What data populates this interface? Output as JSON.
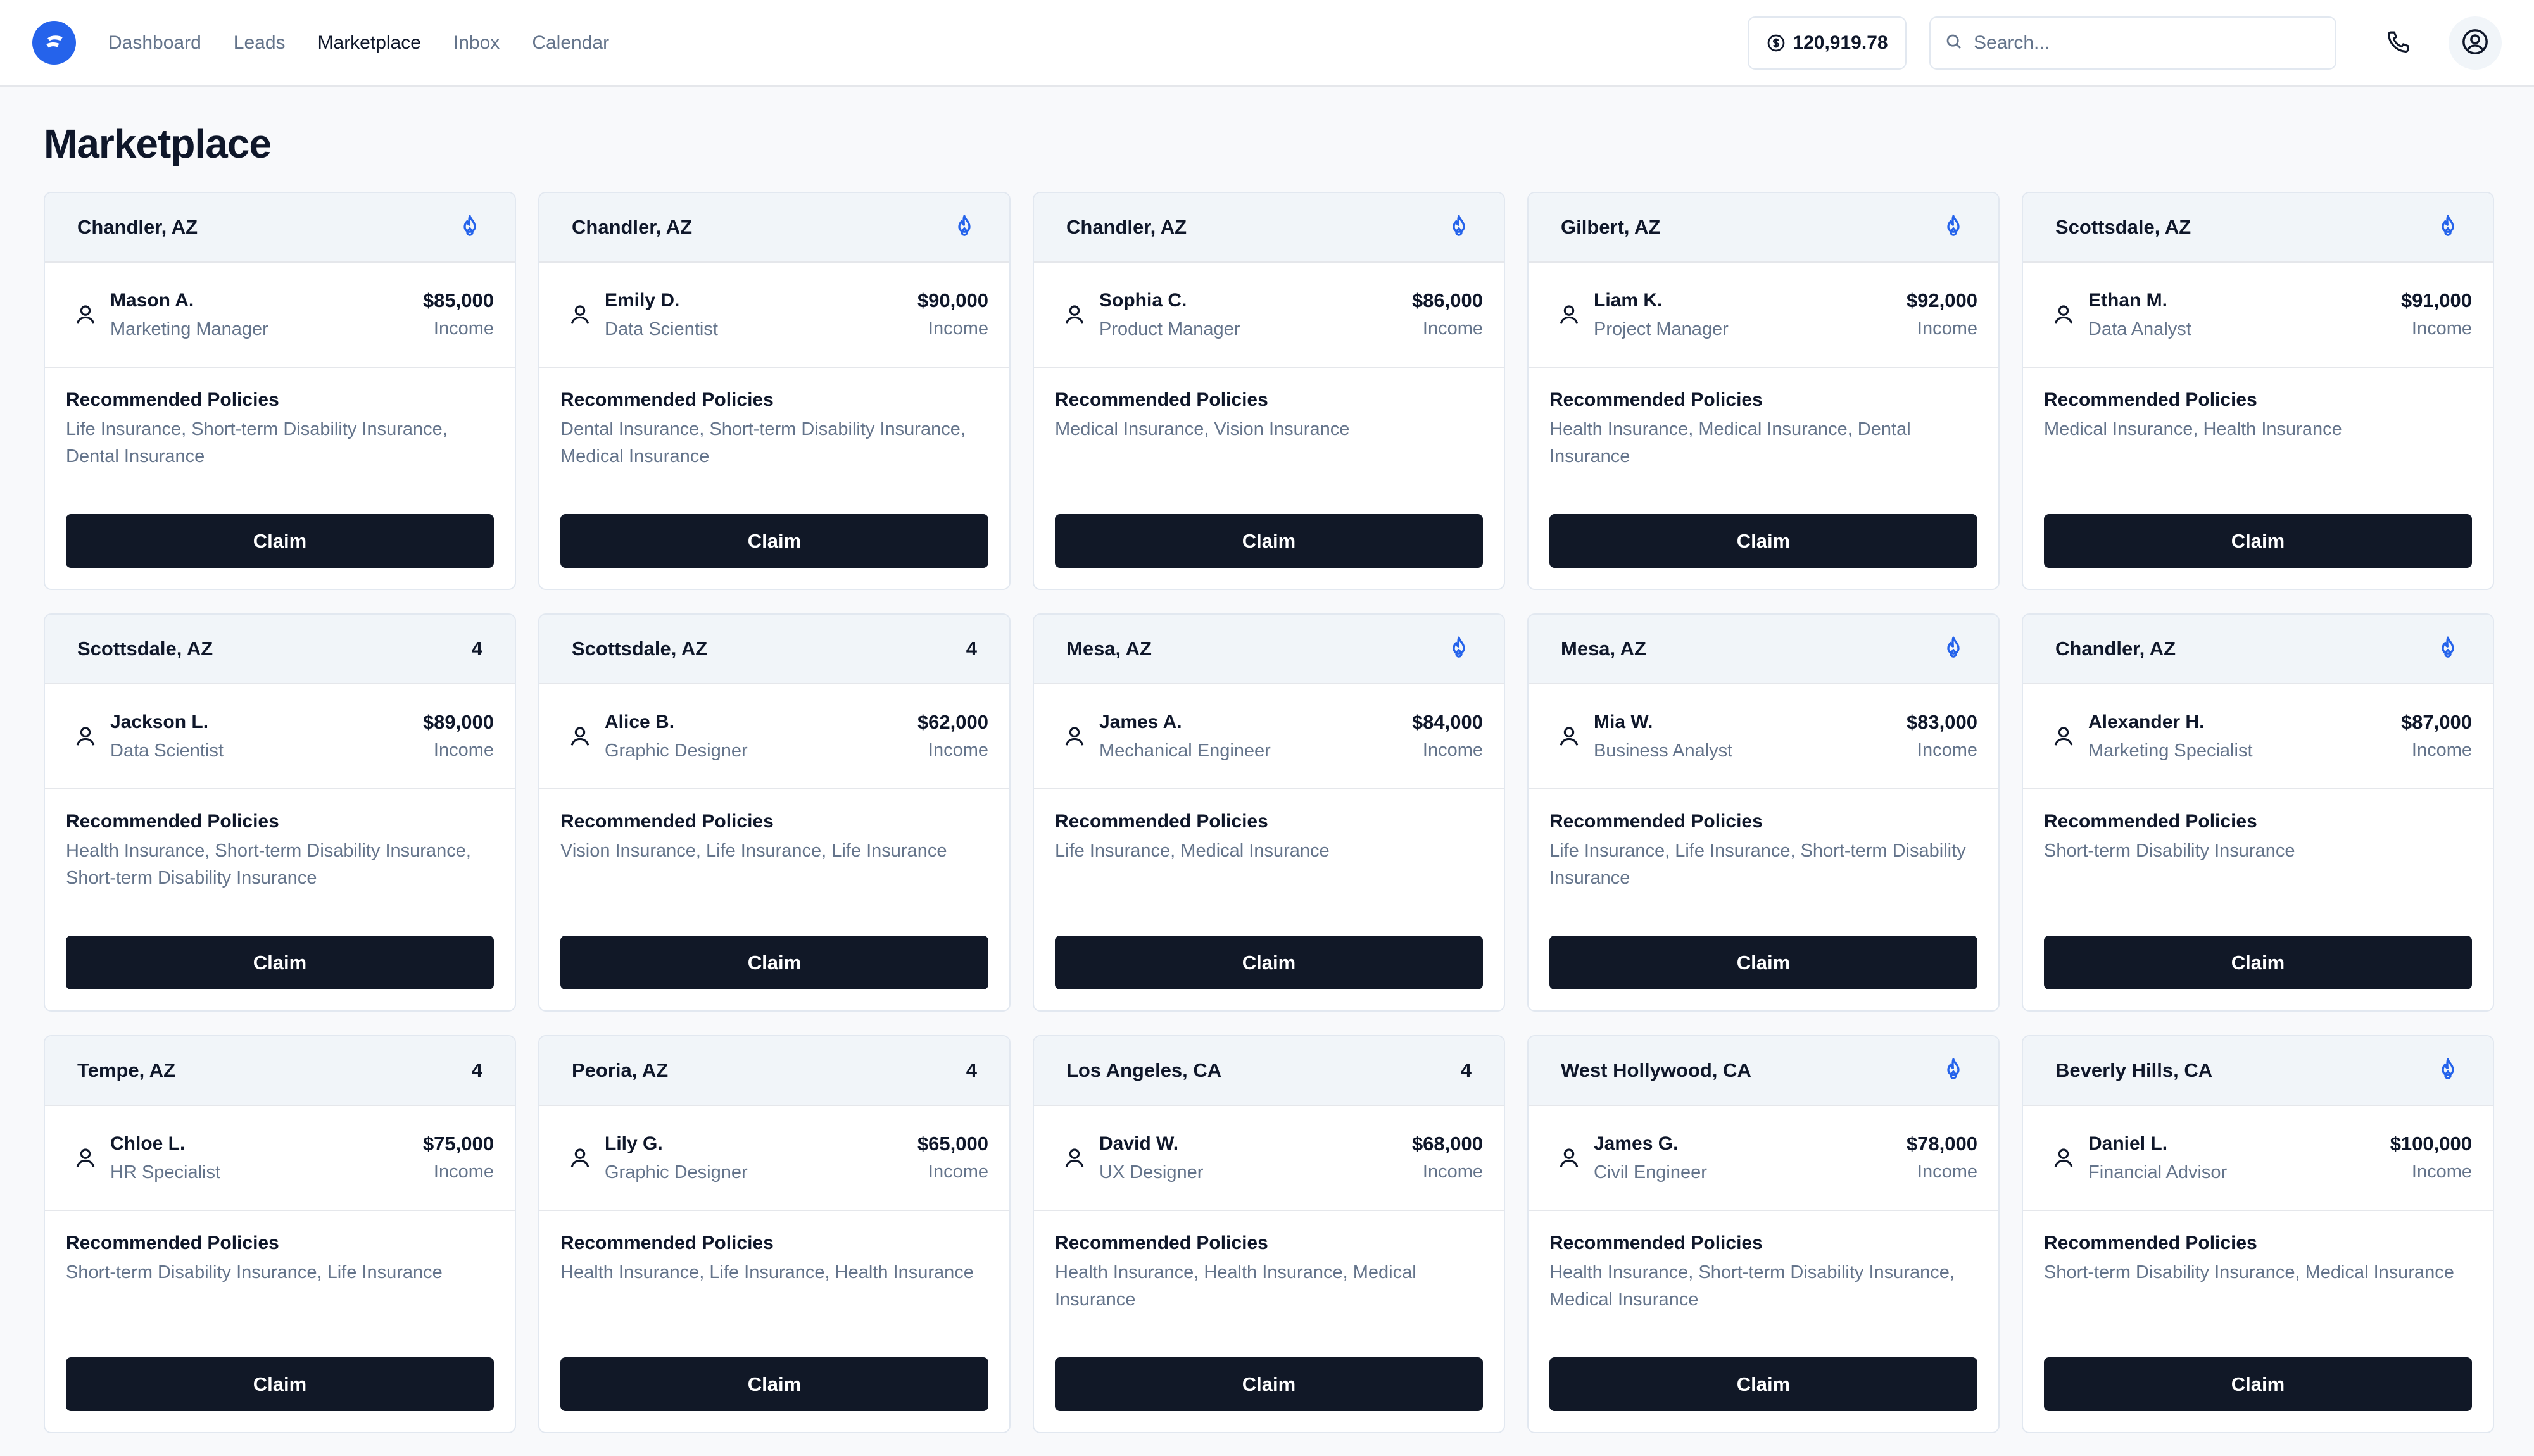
{
  "nav": {
    "links": [
      "Dashboard",
      "Leads",
      "Marketplace",
      "Inbox",
      "Calendar"
    ],
    "active": "Marketplace",
    "balance": "120,919.78",
    "search_placeholder": "Search..."
  },
  "page": {
    "title": "Marketplace"
  },
  "labels": {
    "income": "Income",
    "recommended": "Recommended Policies",
    "claim": "Claim"
  },
  "colors": {
    "accent": "#2563eb",
    "button": "#111827",
    "muted": "#64748b"
  },
  "leads": [
    {
      "location": "Chandler, AZ",
      "badge": "flame-icon",
      "name": "Mason A.",
      "role": "Marketing Manager",
      "income": "$85,000",
      "policies": "Life Insurance, Short-term Disability Insurance, Dental Insurance"
    },
    {
      "location": "Chandler, AZ",
      "badge": "flame-icon",
      "name": "Emily D.",
      "role": "Data Scientist",
      "income": "$90,000",
      "policies": "Dental Insurance, Short-term Disability Insurance, Medical Insurance"
    },
    {
      "location": "Chandler, AZ",
      "badge": "flame-icon",
      "name": "Sophia C.",
      "role": "Product Manager",
      "income": "$86,000",
      "policies": "Medical Insurance, Vision Insurance"
    },
    {
      "location": "Gilbert, AZ",
      "badge": "flame-icon",
      "name": "Liam K.",
      "role": "Project Manager",
      "income": "$92,000",
      "policies": "Health Insurance, Medical Insurance, Dental Insurance"
    },
    {
      "location": "Scottsdale, AZ",
      "badge": "flame-icon",
      "name": "Ethan M.",
      "role": "Data Analyst",
      "income": "$91,000",
      "policies": "Medical Insurance, Health Insurance"
    },
    {
      "location": "Scottsdale, AZ",
      "badge": "4",
      "name": "Jackson L.",
      "role": "Data Scientist",
      "income": "$89,000",
      "policies": "Health Insurance, Short-term Disability Insurance, Short-term Disability Insurance"
    },
    {
      "location": "Scottsdale, AZ",
      "badge": "4",
      "name": "Alice B.",
      "role": "Graphic Designer",
      "income": "$62,000",
      "policies": "Vision Insurance, Life Insurance, Life Insurance"
    },
    {
      "location": "Mesa, AZ",
      "badge": "flame-icon",
      "name": "James A.",
      "role": "Mechanical Engineer",
      "income": "$84,000",
      "policies": "Life Insurance, Medical Insurance"
    },
    {
      "location": "Mesa, AZ",
      "badge": "flame-icon",
      "name": "Mia W.",
      "role": "Business Analyst",
      "income": "$83,000",
      "policies": "Life Insurance, Life Insurance, Short-term Disability Insurance"
    },
    {
      "location": "Chandler, AZ",
      "badge": "flame-icon",
      "name": "Alexander H.",
      "role": "Marketing Specialist",
      "income": "$87,000",
      "policies": "Short-term Disability Insurance"
    },
    {
      "location": "Tempe, AZ",
      "badge": "4",
      "name": "Chloe L.",
      "role": "HR Specialist",
      "income": "$75,000",
      "policies": "Short-term Disability Insurance, Life Insurance"
    },
    {
      "location": "Peoria, AZ",
      "badge": "4",
      "name": "Lily G.",
      "role": "Graphic Designer",
      "income": "$65,000",
      "policies": "Health Insurance, Life Insurance, Health Insurance"
    },
    {
      "location": "Los Angeles, CA",
      "badge": "4",
      "name": "David W.",
      "role": "UX Designer",
      "income": "$68,000",
      "policies": "Health Insurance, Health Insurance, Medical Insurance"
    },
    {
      "location": "West Hollywood, CA",
      "badge": "flame-icon",
      "name": "James G.",
      "role": "Civil Engineer",
      "income": "$78,000",
      "policies": "Health Insurance, Short-term Disability Insurance, Medical Insurance"
    },
    {
      "location": "Beverly Hills, CA",
      "badge": "flame-icon",
      "name": "Daniel L.",
      "role": "Financial Advisor",
      "income": "$100,000",
      "policies": "Short-term Disability Insurance, Medical Insurance"
    }
  ]
}
